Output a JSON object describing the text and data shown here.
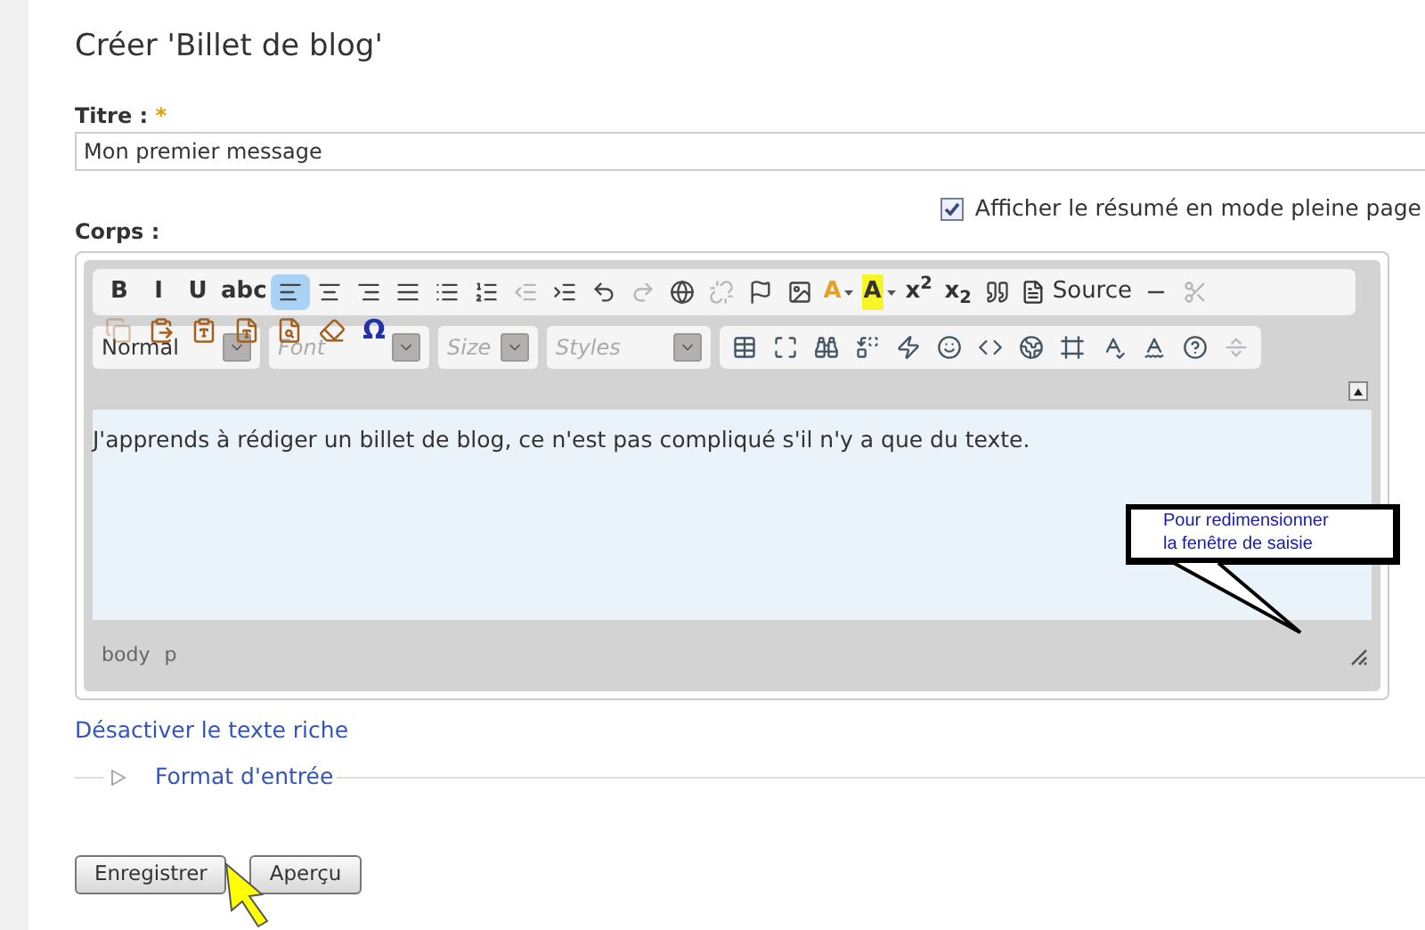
{
  "page_title": "Créer 'Billet de blog'",
  "title_field": {
    "label": "Titre :",
    "required_mark": "*",
    "value": "Mon premier message"
  },
  "summary_option": {
    "label": "Afficher le résumé en mode pleine page",
    "checked": true
  },
  "body_label": "Corps :",
  "toolbar_row_1": [
    {
      "kind": "text",
      "label": "B",
      "selected": false,
      "disabled": false
    },
    {
      "kind": "text",
      "label": "I",
      "selected": false,
      "disabled": false
    },
    {
      "kind": "text",
      "label": "U",
      "selected": false,
      "disabled": false
    },
    {
      "kind": "text",
      "label": "abc",
      "selected": false,
      "disabled": false
    },
    {
      "kind": "icon",
      "selected": true,
      "disabled": false
    },
    {
      "kind": "icon",
      "selected": false,
      "disabled": false
    },
    {
      "kind": "icon",
      "selected": false,
      "disabled": false
    },
    {
      "kind": "icon",
      "selected": false,
      "disabled": false
    },
    {
      "kind": "icon",
      "selected": false,
      "disabled": false
    },
    {
      "kind": "icon",
      "selected": false,
      "disabled": false
    },
    {
      "kind": "icon",
      "selected": false,
      "disabled": true
    },
    {
      "kind": "icon",
      "selected": false,
      "disabled": false
    },
    {
      "kind": "icon",
      "selected": false,
      "disabled": false
    },
    {
      "kind": "icon",
      "selected": false,
      "disabled": true
    },
    {
      "kind": "icon",
      "selected": false,
      "disabled": false
    },
    {
      "kind": "icon",
      "selected": false,
      "disabled": true
    },
    {
      "kind": "icon",
      "selected": false,
      "disabled": false
    },
    {
      "kind": "icon",
      "selected": false,
      "disabled": false
    },
    {
      "kind": "color",
      "label": "A",
      "selected": false,
      "disabled": false
    },
    {
      "kind": "highlight",
      "label": "A",
      "selected": false,
      "disabled": false
    },
    {
      "kind": "text",
      "label": "x$^{2}$",
      "selected": false,
      "disabled": false
    },
    {
      "kind": "text",
      "label": "x$_{2}$",
      "selected": false,
      "disabled": false
    },
    {
      "kind": "icon",
      "selected": false,
      "disabled": false
    },
    {
      "kind": "source",
      "label": "Source",
      "selected": false,
      "disabled": false
    },
    {
      "kind": "icon",
      "selected": false,
      "disabled": false
    },
    {
      "kind": "icon",
      "selected": false,
      "disabled": true
    }
  ],
  "overlay_buttons": [
    {
      "kind": "icon",
      "disabled": true
    },
    {
      "kind": "icon",
      "disabled": false
    },
    {
      "kind": "icon",
      "disabled": false
    },
    {
      "kind": "icon",
      "disabled": false
    },
    {
      "kind": "icon",
      "disabled": false
    },
    {
      "kind": "icon",
      "disabled": false
    },
    {
      "kind": "text",
      "label": "Ω",
      "disabled": false
    }
  ],
  "combos": [
    {
      "label": "Normal",
      "placeholder": false
    },
    {
      "label": "Font",
      "placeholder": true
    },
    {
      "label": "Size",
      "placeholder": true
    },
    {
      "label": "Styles",
      "placeholder": true
    }
  ],
  "toolbar_row_2": [
    {
      "kind": "icon",
      "disabled": false
    },
    {
      "kind": "icon",
      "disabled": false
    },
    {
      "kind": "icon",
      "disabled": false
    },
    {
      "kind": "icon",
      "disabled": false
    },
    {
      "kind": "icon",
      "disabled": false
    },
    {
      "kind": "icon",
      "disabled": false
    },
    {
      "kind": "icon",
      "disabled": false
    },
    {
      "kind": "icon",
      "disabled": false
    },
    {
      "kind": "icon",
      "disabled": false
    },
    {
      "kind": "icon",
      "disabled": false
    },
    {
      "kind": "icon",
      "disabled": false
    },
    {
      "kind": "icon",
      "disabled": false
    },
    {
      "kind": "icon",
      "disabled": true
    }
  ],
  "editor_text": "J'apprends à rédiger un billet de blog, ce n'est pas compliqué s'il n'y a que du texte.",
  "path_bar": [
    "body",
    "p"
  ],
  "callout": {
    "lines": [
      "Pour redimensionner",
      "la fenêtre de saisie"
    ]
  },
  "rich_text_link": "Désactiver le texte riche",
  "input_format": {
    "label": "Format d'entrée",
    "expanded": false
  },
  "buttons": [
    "Enregistrer",
    "Aperçu"
  ]
}
